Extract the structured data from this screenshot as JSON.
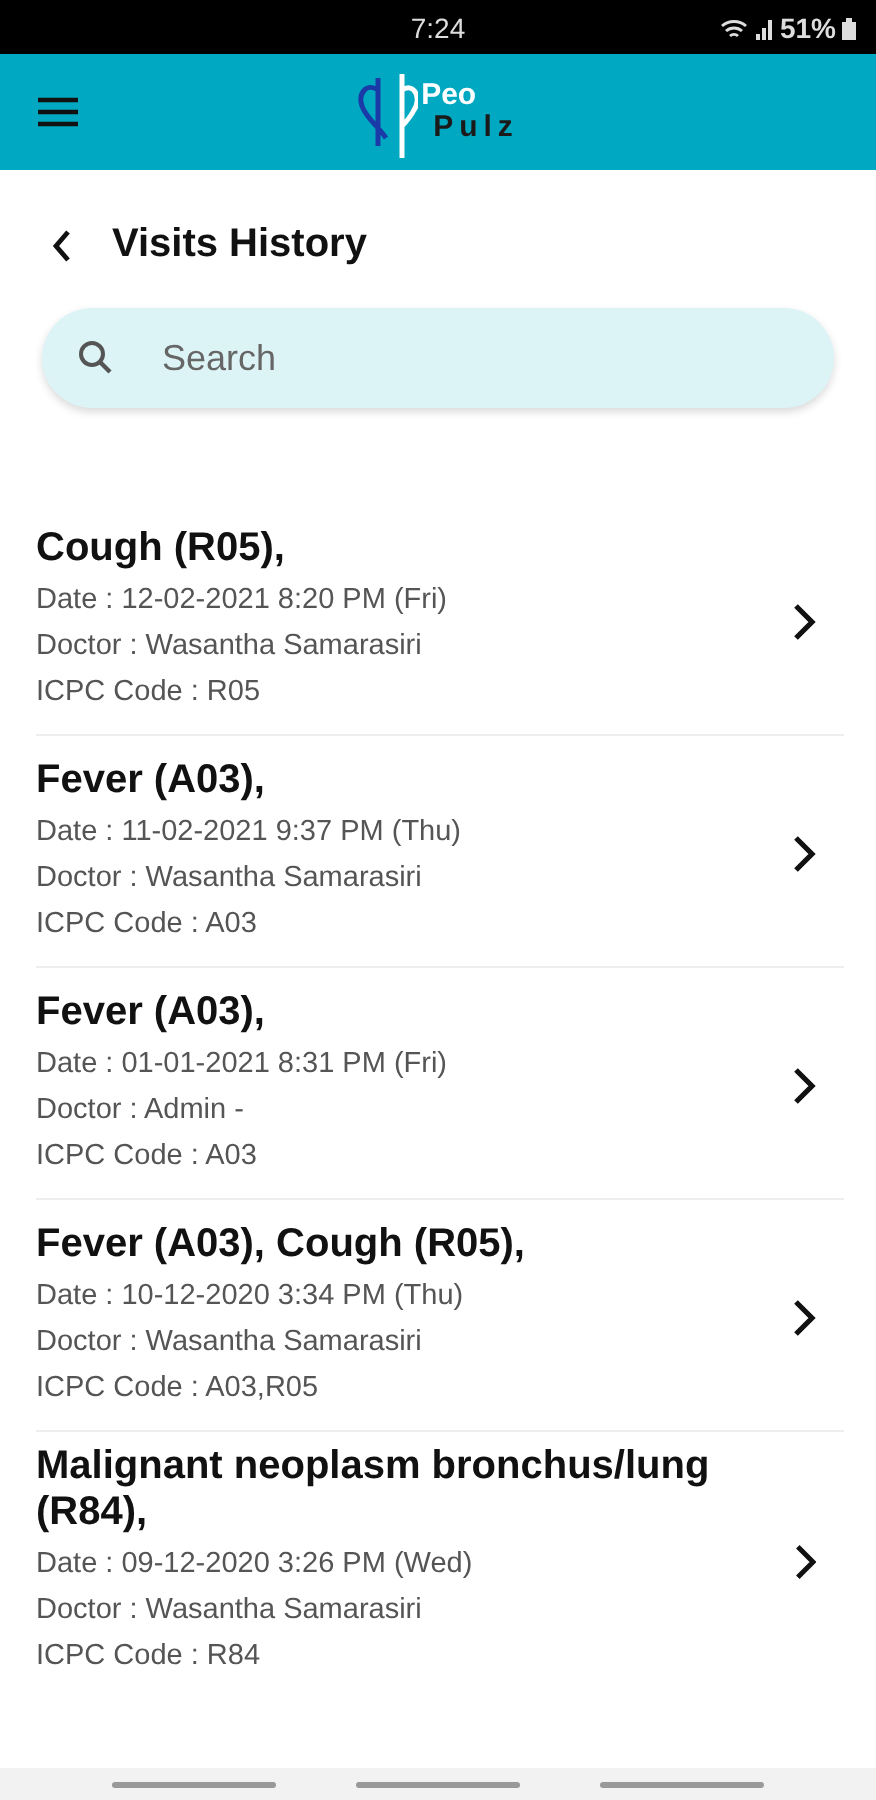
{
  "status_bar": {
    "time": "7:24",
    "battery": "51%"
  },
  "app_bar": {
    "logo_top": "Peo",
    "logo_bottom": "Pulz"
  },
  "page": {
    "title": "Visits History"
  },
  "search": {
    "placeholder": "Search"
  },
  "visits": [
    {
      "title": "Cough (R05),",
      "date": "Date : 12-02-2021 8:20 PM (Fri)",
      "doctor": "Doctor : Wasantha Samarasiri",
      "code": "ICPC Code : R05"
    },
    {
      "title": "Fever (A03),",
      "date": "Date : 11-02-2021 9:37 PM (Thu)",
      "doctor": "Doctor : Wasantha Samarasiri",
      "code": "ICPC Code : A03"
    },
    {
      "title": "Fever (A03),",
      "date": "Date : 01-01-2021 8:31 PM (Fri)",
      "doctor": "Doctor : Admin -",
      "code": "ICPC Code : A03"
    },
    {
      "title": "Fever (A03), Cough (R05),",
      "date": "Date : 10-12-2020 3:34 PM (Thu)",
      "doctor": "Doctor : Wasantha Samarasiri",
      "code": "ICPC Code : A03,R05"
    },
    {
      "title": "Malignant neoplasm bronchus/lung (R84),",
      "date": "Date : 09-12-2020 3:26 PM (Wed)",
      "doctor": "Doctor : Wasantha Samarasiri",
      "code": "ICPC Code : R84"
    }
  ]
}
